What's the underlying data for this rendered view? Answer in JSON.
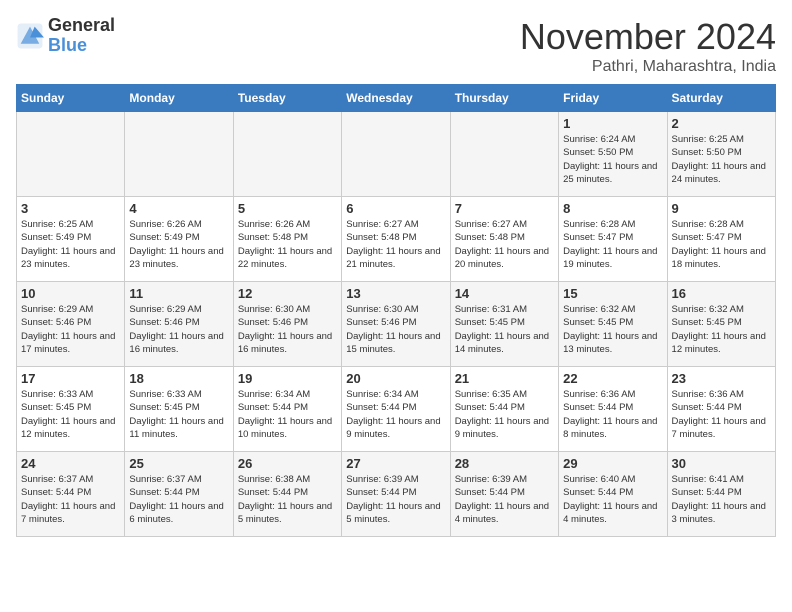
{
  "header": {
    "logo_general": "General",
    "logo_blue": "Blue",
    "month_title": "November 2024",
    "subtitle": "Pathri, Maharashtra, India"
  },
  "weekdays": [
    "Sunday",
    "Monday",
    "Tuesday",
    "Wednesday",
    "Thursday",
    "Friday",
    "Saturday"
  ],
  "weeks": [
    [
      {
        "day": "",
        "info": ""
      },
      {
        "day": "",
        "info": ""
      },
      {
        "day": "",
        "info": ""
      },
      {
        "day": "",
        "info": ""
      },
      {
        "day": "",
        "info": ""
      },
      {
        "day": "1",
        "info": "Sunrise: 6:24 AM\nSunset: 5:50 PM\nDaylight: 11 hours and 25 minutes."
      },
      {
        "day": "2",
        "info": "Sunrise: 6:25 AM\nSunset: 5:50 PM\nDaylight: 11 hours and 24 minutes."
      }
    ],
    [
      {
        "day": "3",
        "info": "Sunrise: 6:25 AM\nSunset: 5:49 PM\nDaylight: 11 hours and 23 minutes."
      },
      {
        "day": "4",
        "info": "Sunrise: 6:26 AM\nSunset: 5:49 PM\nDaylight: 11 hours and 23 minutes."
      },
      {
        "day": "5",
        "info": "Sunrise: 6:26 AM\nSunset: 5:48 PM\nDaylight: 11 hours and 22 minutes."
      },
      {
        "day": "6",
        "info": "Sunrise: 6:27 AM\nSunset: 5:48 PM\nDaylight: 11 hours and 21 minutes."
      },
      {
        "day": "7",
        "info": "Sunrise: 6:27 AM\nSunset: 5:48 PM\nDaylight: 11 hours and 20 minutes."
      },
      {
        "day": "8",
        "info": "Sunrise: 6:28 AM\nSunset: 5:47 PM\nDaylight: 11 hours and 19 minutes."
      },
      {
        "day": "9",
        "info": "Sunrise: 6:28 AM\nSunset: 5:47 PM\nDaylight: 11 hours and 18 minutes."
      }
    ],
    [
      {
        "day": "10",
        "info": "Sunrise: 6:29 AM\nSunset: 5:46 PM\nDaylight: 11 hours and 17 minutes."
      },
      {
        "day": "11",
        "info": "Sunrise: 6:29 AM\nSunset: 5:46 PM\nDaylight: 11 hours and 16 minutes."
      },
      {
        "day": "12",
        "info": "Sunrise: 6:30 AM\nSunset: 5:46 PM\nDaylight: 11 hours and 16 minutes."
      },
      {
        "day": "13",
        "info": "Sunrise: 6:30 AM\nSunset: 5:46 PM\nDaylight: 11 hours and 15 minutes."
      },
      {
        "day": "14",
        "info": "Sunrise: 6:31 AM\nSunset: 5:45 PM\nDaylight: 11 hours and 14 minutes."
      },
      {
        "day": "15",
        "info": "Sunrise: 6:32 AM\nSunset: 5:45 PM\nDaylight: 11 hours and 13 minutes."
      },
      {
        "day": "16",
        "info": "Sunrise: 6:32 AM\nSunset: 5:45 PM\nDaylight: 11 hours and 12 minutes."
      }
    ],
    [
      {
        "day": "17",
        "info": "Sunrise: 6:33 AM\nSunset: 5:45 PM\nDaylight: 11 hours and 12 minutes."
      },
      {
        "day": "18",
        "info": "Sunrise: 6:33 AM\nSunset: 5:45 PM\nDaylight: 11 hours and 11 minutes."
      },
      {
        "day": "19",
        "info": "Sunrise: 6:34 AM\nSunset: 5:44 PM\nDaylight: 11 hours and 10 minutes."
      },
      {
        "day": "20",
        "info": "Sunrise: 6:34 AM\nSunset: 5:44 PM\nDaylight: 11 hours and 9 minutes."
      },
      {
        "day": "21",
        "info": "Sunrise: 6:35 AM\nSunset: 5:44 PM\nDaylight: 11 hours and 9 minutes."
      },
      {
        "day": "22",
        "info": "Sunrise: 6:36 AM\nSunset: 5:44 PM\nDaylight: 11 hours and 8 minutes."
      },
      {
        "day": "23",
        "info": "Sunrise: 6:36 AM\nSunset: 5:44 PM\nDaylight: 11 hours and 7 minutes."
      }
    ],
    [
      {
        "day": "24",
        "info": "Sunrise: 6:37 AM\nSunset: 5:44 PM\nDaylight: 11 hours and 7 minutes."
      },
      {
        "day": "25",
        "info": "Sunrise: 6:37 AM\nSunset: 5:44 PM\nDaylight: 11 hours and 6 minutes."
      },
      {
        "day": "26",
        "info": "Sunrise: 6:38 AM\nSunset: 5:44 PM\nDaylight: 11 hours and 5 minutes."
      },
      {
        "day": "27",
        "info": "Sunrise: 6:39 AM\nSunset: 5:44 PM\nDaylight: 11 hours and 5 minutes."
      },
      {
        "day": "28",
        "info": "Sunrise: 6:39 AM\nSunset: 5:44 PM\nDaylight: 11 hours and 4 minutes."
      },
      {
        "day": "29",
        "info": "Sunrise: 6:40 AM\nSunset: 5:44 PM\nDaylight: 11 hours and 4 minutes."
      },
      {
        "day": "30",
        "info": "Sunrise: 6:41 AM\nSunset: 5:44 PM\nDaylight: 11 hours and 3 minutes."
      }
    ]
  ]
}
